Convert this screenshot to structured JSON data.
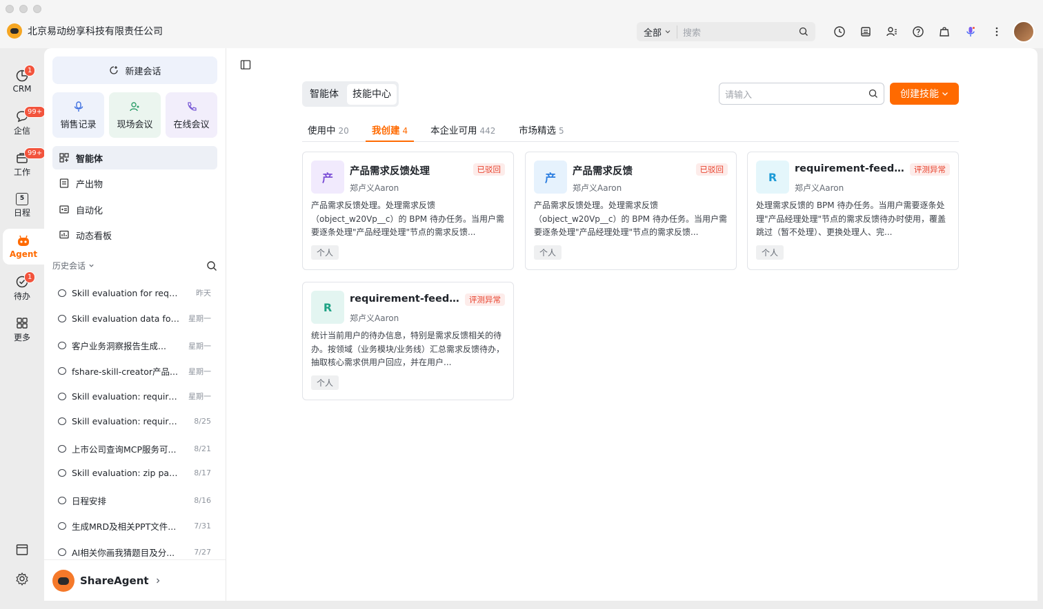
{
  "window": {
    "company": "北京易动纷享科技有限责任公司"
  },
  "top_search": {
    "scope": "全部",
    "placeholder": "搜索"
  },
  "rail": {
    "crm": {
      "label": "CRM",
      "badge": "1"
    },
    "chat": {
      "label": "企信",
      "badge": "99+"
    },
    "work": {
      "label": "工作",
      "badge": "99+"
    },
    "calendar": {
      "label": "日程",
      "day": "5"
    },
    "agent": {
      "label": "Agent"
    },
    "todo": {
      "label": "待办",
      "badge": "1"
    },
    "more": {
      "label": "更多"
    }
  },
  "sidebar": {
    "new_chat": "新建会话",
    "quick": [
      {
        "label": "销售记录",
        "icon": "mic-icon"
      },
      {
        "label": "现场会议",
        "icon": "people-icon"
      },
      {
        "label": "在线会议",
        "icon": "phone-icon"
      }
    ],
    "nav": [
      {
        "label": "智能体",
        "icon": "grid-icon"
      },
      {
        "label": "产出物",
        "icon": "document-icon"
      },
      {
        "label": "自动化",
        "icon": "automation-icon"
      },
      {
        "label": "动态看板",
        "icon": "dashboard-icon"
      }
    ],
    "history_title": "历史会话",
    "history": [
      {
        "title": "Skill evaluation for require...",
        "date": "昨天"
      },
      {
        "title": "Skill evaluation data for ...",
        "date": "星期一"
      },
      {
        "title": "客户业务洞察报告生成...",
        "date": "星期一"
      },
      {
        "title": "fshare-skill-creator产品...",
        "date": "星期一"
      },
      {
        "title": "Skill evaluation: require...",
        "date": "星期一"
      },
      {
        "title": "Skill evaluation: requireme...",
        "date": "8/25"
      },
      {
        "title": "上市公司查询MCP服务可...",
        "date": "8/21"
      },
      {
        "title": "Skill evaluation: zip path a...",
        "date": "8/17"
      },
      {
        "title": "日程安排",
        "date": "8/16"
      },
      {
        "title": "生成MRD及相关PPT文件...",
        "date": "7/31"
      },
      {
        "title": "AI相关你画我猜题目及分...",
        "date": "7/27"
      }
    ],
    "footer_name": "ShareAgent"
  },
  "main": {
    "segment": [
      "智能体",
      "技能中心"
    ],
    "search_placeholder": "请输入",
    "create_button": "创建技能",
    "tabs": [
      {
        "label": "使用中",
        "count": "20"
      },
      {
        "label": "我创建",
        "count": "4"
      },
      {
        "label": "本企业可用",
        "count": "442"
      },
      {
        "label": "市场精选",
        "count": "5"
      }
    ],
    "cards": [
      {
        "icon_text": "产",
        "icon_bg": "#f1eafd",
        "icon_color": "#7b4fd6",
        "title": "产品需求反馈处理",
        "author": "郑卢义Aaron",
        "status": "已驳回",
        "desc": "产品需求反馈处理。处理需求反馈（object_w20Vp__c）的 BPM 待办任务。当用户需要逐条处理\"产品经理处理\"节点的需求反馈...",
        "tag": "个人"
      },
      {
        "icon_text": "产",
        "icon_bg": "#e6f2fd",
        "icon_color": "#2b7de0",
        "title": "产品需求反馈",
        "author": "郑卢义Aaron",
        "status": "已驳回",
        "desc": "产品需求反馈处理。处理需求反馈（object_w20Vp__c）的 BPM 待办任务。当用户需要逐条处理\"产品经理处理\"节点的需求反馈...",
        "tag": "个人"
      },
      {
        "icon_text": "R",
        "icon_bg": "#e4f6fb",
        "icon_color": "#1c9ad6",
        "title": "requirement-feedback...",
        "author": "郑卢义Aaron",
        "status": "评测异常",
        "desc": "处理需求反馈的 BPM 待办任务。当用户需要逐条处理\"产品经理处理\"节点的需求反馈待办时使用，覆盖跳过（暂不处理）、更换处理人、完...",
        "tag": "个人"
      },
      {
        "icon_text": "R",
        "icon_bg": "#e3f5f1",
        "icon_color": "#1fa385",
        "title": "requirement-feedback...",
        "author": "郑卢义Aaron",
        "status": "评测异常",
        "desc": "统计当前用户的待办信息，特别是需求反馈相关的待办。按领域（业务模块/业务线）汇总需求反馈待办，抽取核心需求供用户回应，并在用户...",
        "tag": "个人"
      }
    ]
  }
}
